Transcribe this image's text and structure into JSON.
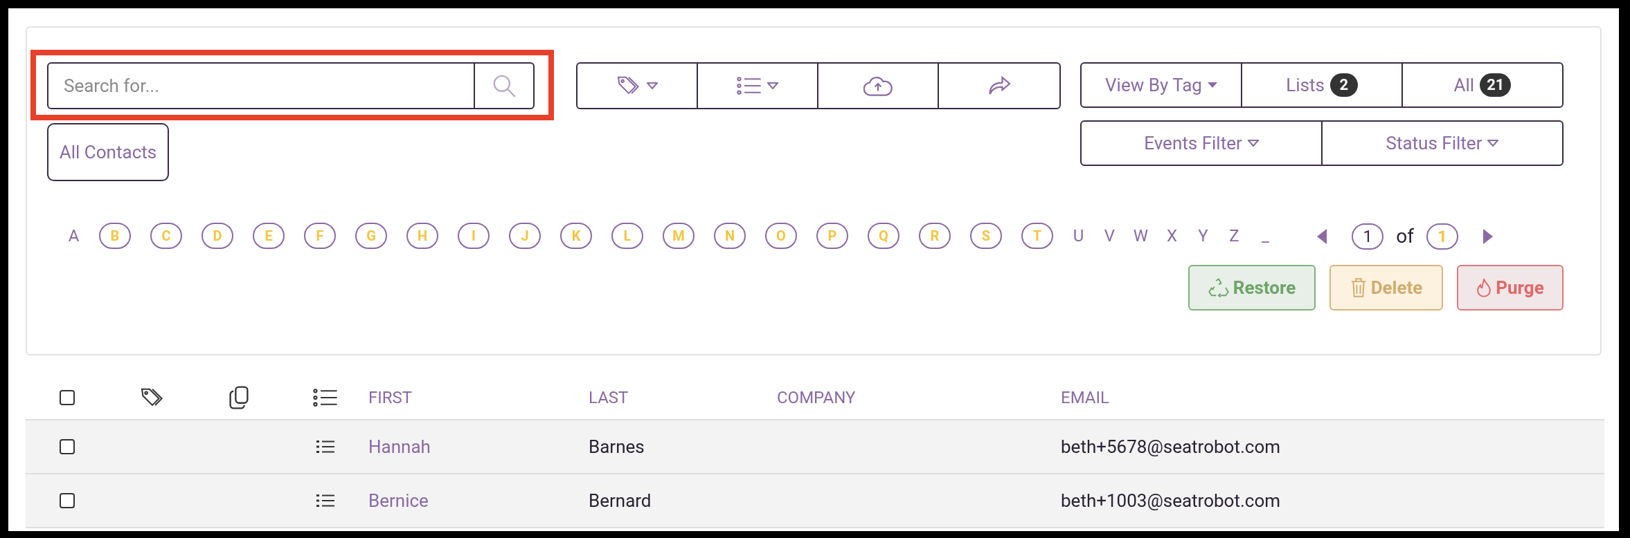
{
  "search": {
    "placeholder": "Search for..."
  },
  "toolbar": {
    "dropdowns": [
      "View By Tag"
    ],
    "counters": [
      {
        "label": "Lists",
        "count": "2"
      },
      {
        "label": "All",
        "count": "21"
      }
    ],
    "filters": [
      "Events Filter",
      "Status Filter"
    ]
  },
  "all_contacts": "All Contacts",
  "alphabet": [
    {
      "letter": "A",
      "available": false
    },
    {
      "letter": "B",
      "available": true
    },
    {
      "letter": "C",
      "available": true
    },
    {
      "letter": "D",
      "available": true
    },
    {
      "letter": "E",
      "available": true
    },
    {
      "letter": "F",
      "available": true
    },
    {
      "letter": "G",
      "available": true
    },
    {
      "letter": "H",
      "available": true
    },
    {
      "letter": "I",
      "available": true
    },
    {
      "letter": "J",
      "available": true
    },
    {
      "letter": "K",
      "available": true
    },
    {
      "letter": "L",
      "available": true
    },
    {
      "letter": "M",
      "available": true
    },
    {
      "letter": "N",
      "available": true
    },
    {
      "letter": "O",
      "available": true
    },
    {
      "letter": "P",
      "available": true
    },
    {
      "letter": "Q",
      "available": true
    },
    {
      "letter": "R",
      "available": true
    },
    {
      "letter": "S",
      "available": true
    },
    {
      "letter": "T",
      "available": true
    },
    {
      "letter": "U",
      "available": false
    },
    {
      "letter": "V",
      "available": false
    },
    {
      "letter": "W",
      "available": false
    },
    {
      "letter": "X",
      "available": false
    },
    {
      "letter": "Y",
      "available": false
    },
    {
      "letter": "Z",
      "available": false
    },
    {
      "letter": "_",
      "available": false
    }
  ],
  "pagination": {
    "page": "1",
    "of": "of",
    "total": "1"
  },
  "actions": [
    {
      "kind": "restore",
      "label": "Restore"
    },
    {
      "kind": "delete",
      "label": "Delete"
    },
    {
      "kind": "purge",
      "label": "Purge"
    }
  ],
  "table": {
    "select_all_checked": false,
    "columns": [
      "FIRST",
      "LAST",
      "COMPANY",
      "EMAIL"
    ],
    "rows": [
      {
        "checked": false,
        "first": "Hannah",
        "last": "Barnes",
        "email": "beth+5678@seatrobot.com"
      },
      {
        "checked": false,
        "first": "Bernice",
        "last": "Bernard",
        "email": "beth+1003@seatrobot.com"
      }
    ]
  }
}
